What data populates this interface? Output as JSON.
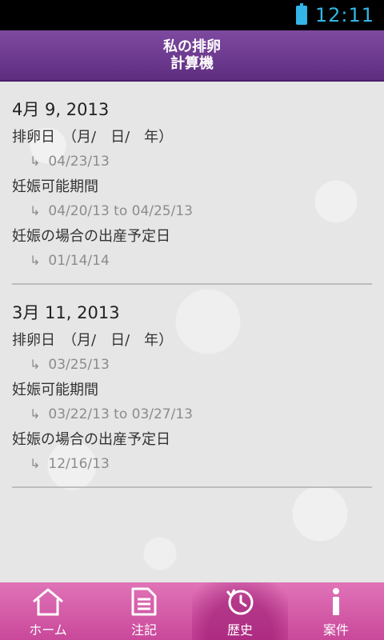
{
  "status_bar": {
    "time": "12:11"
  },
  "header": {
    "title_line1": "私の排卵",
    "title_line2": "計算機"
  },
  "records": [
    {
      "date": "4月 9, 2013",
      "ovulation_label": "排卵日　（月/　日/　年）",
      "ovulation_value": "04/23/13",
      "fertile_label": "妊娠可能期間",
      "fertile_value": "04/20/13 to 04/25/13",
      "due_label": "妊娠の場合の出産予定日",
      "due_value": "01/14/14"
    },
    {
      "date": "3月 11, 2013",
      "ovulation_label": "排卵日　（月/　日/　年）",
      "ovulation_value": "03/25/13",
      "fertile_label": "妊娠可能期間",
      "fertile_value": "03/22/13 to 03/27/13",
      "due_label": "妊娠の場合の出産予定日",
      "due_value": "12/16/13"
    }
  ],
  "tabs": {
    "home": "ホーム",
    "notes": "注記",
    "history": "歴史",
    "about": "案件"
  },
  "colors": {
    "header": "#6a3590",
    "tabbar": "#d55aa8",
    "status_accent": "#33b5e5"
  }
}
